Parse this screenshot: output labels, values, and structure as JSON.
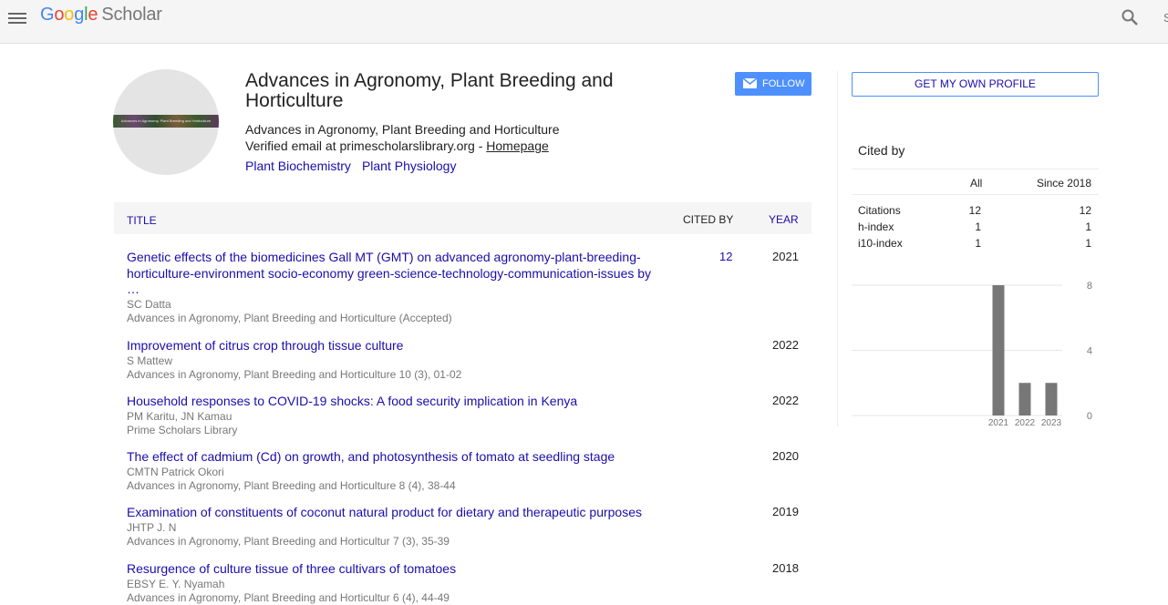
{
  "header": {
    "logo_letters": [
      "G",
      "o",
      "o",
      "g",
      "l",
      "e"
    ],
    "logo_suffix": "Scholar",
    "signin": "S"
  },
  "profile": {
    "avatar_text": "Advances in Agronomy, Plant Breeding and Horticulture",
    "name": "Advances in Agronomy, Plant Breeding and Horticulture",
    "affiliation": "Advances in Agronomy, Plant Breeding and Horticulture",
    "email_text": "Verified email at primescholarslibrary.org - ",
    "homepage_label": "Homepage",
    "interests": [
      "Plant Biochemistry",
      "Plant Physiology"
    ],
    "follow_label": "FOLLOW"
  },
  "table": {
    "col_title": "TITLE",
    "col_cited": "CITED BY",
    "col_year": "YEAR",
    "rows": [
      {
        "title": "Genetic effects of the biomedicines Gall MT (GMT) on advanced agronomy-plant-breeding-horticulture-environment socio-economy green-science-technology-communication-issues by …",
        "authors": "SC Datta",
        "venue": "Advances in Agronomy, Plant Breeding and Horticulture (Accepted)",
        "cited": "12",
        "year": "2021"
      },
      {
        "title": "Improvement of citrus crop through tissue culture",
        "authors": "S Mattew",
        "venue": "Advances in Agronomy, Plant Breeding and Horticulture 10 (3), 01-02",
        "cited": "",
        "year": "2022"
      },
      {
        "title": "Household responses to COVID-19 shocks: A food security implication in Kenya",
        "authors": "PM Karitu, JN Kamau",
        "venue": "Prime Scholars Library",
        "cited": "",
        "year": "2022"
      },
      {
        "title": "The effect of cadmium (Cd) on growth, and photosynthesis of tomato at seedling stage",
        "authors": "CMTN Patrick Okori",
        "venue": "Advances in Agronomy, Plant Breeding and Horticulture 8 (4), 38-44",
        "cited": "",
        "year": "2020"
      },
      {
        "title": "Examination of constituents of coconut natural product for dietary and therapeutic purposes",
        "authors": "JHTP J. N",
        "venue": "Advances in Agronomy, Plant Breeding and Horticultur 7 (3), 35-39",
        "cited": "",
        "year": "2019"
      },
      {
        "title": "Resurgence of culture tissue of three cultivars of tomatoes",
        "authors": "EBSY E. Y. Nyamah",
        "venue": "Advances in Agronomy, Plant Breeding and Horticultur 6 (4), 44-49",
        "cited": "",
        "year": "2018"
      }
    ]
  },
  "sidebar": {
    "own_profile_label": "GET MY OWN PROFILE",
    "cited_by_title": "Cited by",
    "col_all": "All",
    "col_since": "Since 2018",
    "stats": [
      {
        "label": "Citations",
        "all": "12",
        "since": "12"
      },
      {
        "label": "h-index",
        "all": "1",
        "since": "1"
      },
      {
        "label": "i10-index",
        "all": "1",
        "since": "1"
      }
    ]
  },
  "chart_data": {
    "type": "bar",
    "categories": [
      "2021",
      "2022",
      "2023"
    ],
    "values": [
      8,
      2,
      2
    ],
    "ylim": [
      0,
      8
    ],
    "yticks": [
      0,
      4,
      8
    ],
    "grid": true,
    "bar_color": "#777777"
  }
}
